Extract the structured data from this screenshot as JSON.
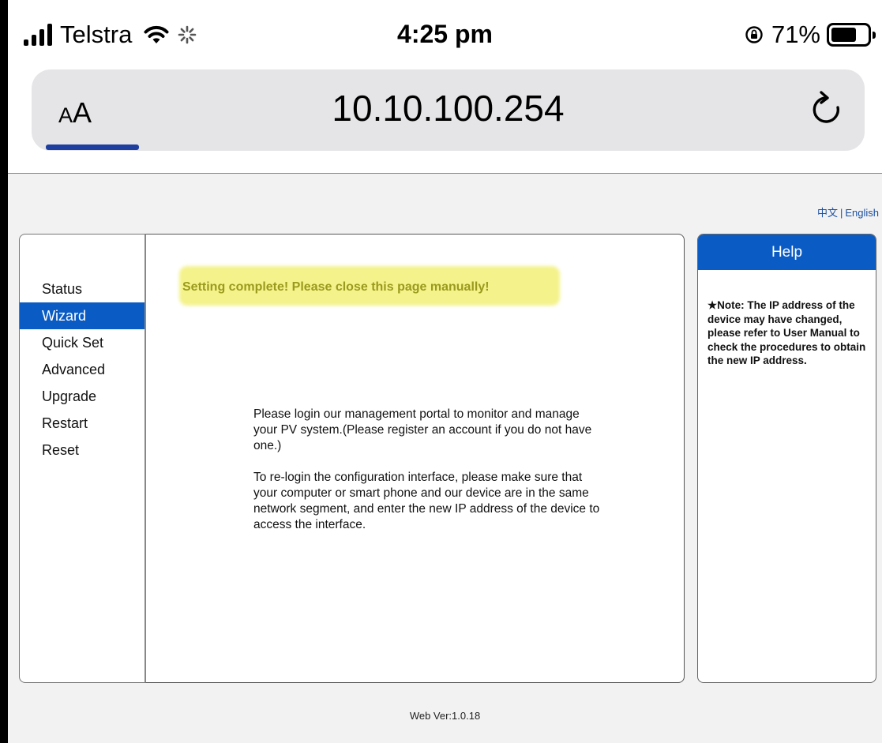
{
  "status_bar": {
    "carrier": "Telstra",
    "time": "4:25 pm",
    "battery_percent": "71%",
    "battery_level": 0.71,
    "icons": [
      "signal-icon",
      "wifi-icon",
      "loading-spinner-icon",
      "rotation-lock-icon",
      "battery-icon"
    ]
  },
  "browser": {
    "text_size_button": {
      "large": "A",
      "small": "A"
    },
    "url": "10.10.100.254",
    "reload_icon": "reload-icon",
    "accent_color": "#1f3fa0"
  },
  "page": {
    "language": {
      "chinese": "中文",
      "separator": "|",
      "english": "English"
    },
    "menu": [
      {
        "label": "Status",
        "active": false
      },
      {
        "label": "Wizard",
        "active": true
      },
      {
        "label": "Quick Set",
        "active": false
      },
      {
        "label": "Advanced",
        "active": false
      },
      {
        "label": "Upgrade",
        "active": false
      },
      {
        "label": "Restart",
        "active": false
      },
      {
        "label": "Reset",
        "active": false
      }
    ],
    "success_message": "Setting complete! Please close this page manually!",
    "info_paragraphs": [
      "Please login our management portal to monitor and manage your PV system.(Please register an account if you do not have one.)",
      "To re-login the configuration interface, please make sure that your computer or smart phone and our device are in the same network segment, and enter the new IP address of the device to access the interface."
    ],
    "help": {
      "title": "Help",
      "note": "★Note: The IP address of the device may have changed, please refer to User Manual to check the procedures to obtain the new IP address."
    },
    "footer": "Web Ver:1.0.18",
    "colors": {
      "menu_active": "#0a5cc4",
      "highlight": "#f4f28a",
      "success_text": "#9a9a1e"
    }
  }
}
